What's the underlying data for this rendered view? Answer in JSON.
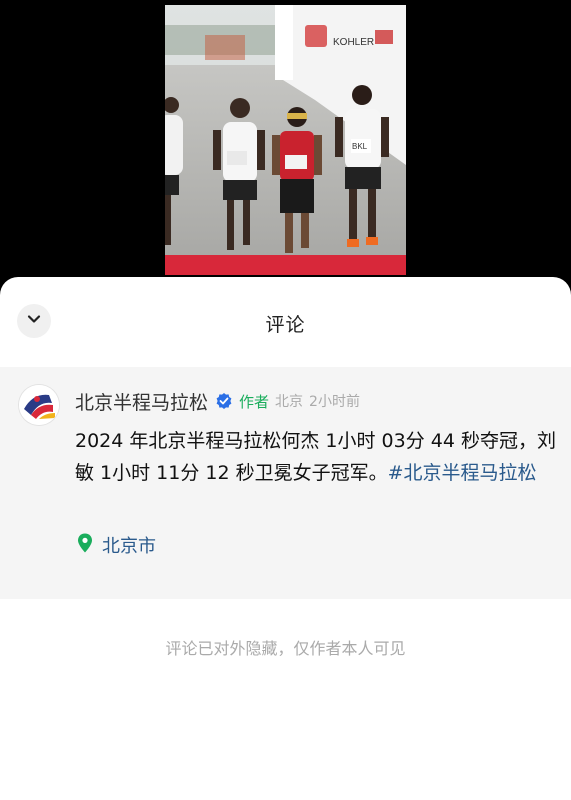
{
  "sheet": {
    "title": "评论",
    "collapse_icon": "chevron-down-icon"
  },
  "comment": {
    "username": "北京半程马拉松",
    "author_tag": "作者",
    "location_short": "北京",
    "time": "2小时前",
    "text_plain": "2024 年北京半程马拉松何杰 1小时 03分 44 秒夺冠，刘敏 1小时 11分 12 秒卫冕女子冠军。",
    "hashtag": "#北京半程马拉松",
    "location": "北京市"
  },
  "note": "评论已对外隐藏，仅作者本人可见",
  "photo": {
    "sponsor_text": "KOHLER",
    "bib_text": "BKL"
  },
  "colors": {
    "accent_green": "#1aad5c",
    "verified_blue": "#2b6fe6",
    "link_blue": "#2a5a8c",
    "location_green": "#1aad5c"
  }
}
